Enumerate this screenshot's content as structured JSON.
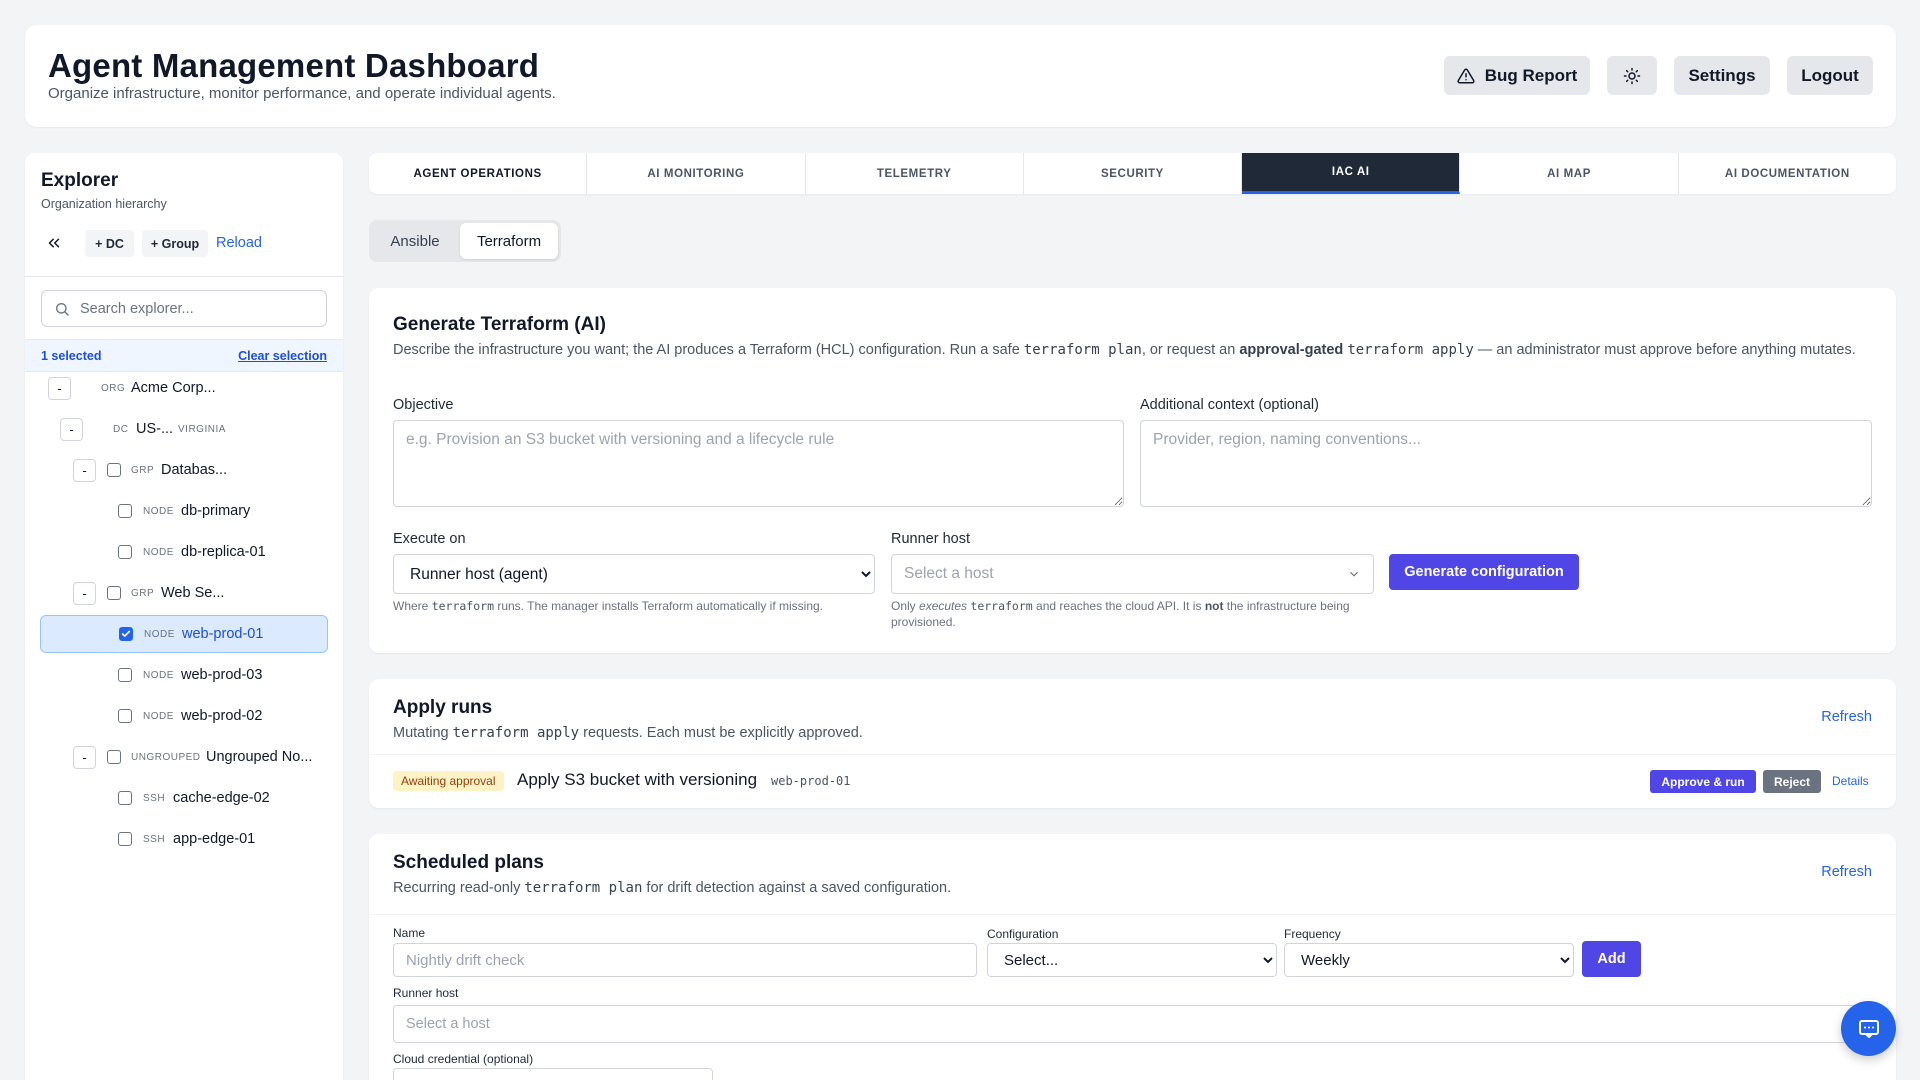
{
  "header": {
    "title": "Agent Management Dashboard",
    "subtitle": "Organize infrastructure, monitor performance, and operate individual agents.",
    "bug_report": "Bug Report",
    "settings": "Settings",
    "logout": "Logout"
  },
  "sidebar": {
    "title": "Explorer",
    "subtitle": "Organization hierarchy",
    "add_dc": "+ DC",
    "add_group": "+ Group",
    "reload": "Reload",
    "search_placeholder": "Search explorer...",
    "selected_count": "1 selected",
    "clear_selection": "Clear selection",
    "tree": [
      {
        "toggle": "-",
        "type": "ORG",
        "label": "Acme Corp...",
        "meta": "",
        "checkbox": false,
        "checked": false
      },
      {
        "toggle": "-",
        "type": "DC",
        "label": "US-...",
        "meta": "VIRGINIA",
        "checkbox": false,
        "checked": false
      },
      {
        "toggle": "-",
        "type": "GRP",
        "label": "Databas...",
        "meta": "",
        "checkbox": true,
        "checked": false
      },
      {
        "toggle": "",
        "type": "NODE",
        "label": "db-primary",
        "meta": "",
        "checkbox": true,
        "checked": false
      },
      {
        "toggle": "",
        "type": "NODE",
        "label": "db-replica-01",
        "meta": "",
        "checkbox": true,
        "checked": false
      },
      {
        "toggle": "-",
        "type": "GRP",
        "label": "Web Se...",
        "meta": "",
        "checkbox": true,
        "checked": false
      },
      {
        "toggle": "",
        "type": "NODE",
        "label": "web-prod-01",
        "meta": "",
        "checkbox": true,
        "checked": true
      },
      {
        "toggle": "",
        "type": "NODE",
        "label": "web-prod-03",
        "meta": "",
        "checkbox": true,
        "checked": false
      },
      {
        "toggle": "",
        "type": "NODE",
        "label": "web-prod-02",
        "meta": "",
        "checkbox": true,
        "checked": false
      },
      {
        "toggle": "-",
        "type": "UNGROUPED",
        "label": "Ungrouped No...",
        "meta": "",
        "checkbox": true,
        "checked": false
      },
      {
        "toggle": "",
        "type": "SSH",
        "label": "cache-edge-02",
        "meta": "",
        "checkbox": true,
        "checked": false
      },
      {
        "toggle": "",
        "type": "SSH",
        "label": "app-edge-01",
        "meta": "",
        "checkbox": true,
        "checked": false
      }
    ]
  },
  "tabs": [
    {
      "label": "AGENT OPERATIONS",
      "active": false
    },
    {
      "label": "AI MONITORING",
      "active": false
    },
    {
      "label": "TELEMETRY",
      "active": false
    },
    {
      "label": "SECURITY",
      "active": false
    },
    {
      "label": "IAC AI",
      "active": true
    },
    {
      "label": "AI MAP",
      "active": false
    },
    {
      "label": "AI DOCUMENTATION",
      "active": false
    }
  ],
  "subtabs": {
    "ansible": "Ansible",
    "terraform": "Terraform",
    "active": "Terraform"
  },
  "generate": {
    "title": "Generate Terraform (AI)",
    "desc_1": "Describe the infrastructure you want; the AI produces a Terraform (HCL) configuration. Run a safe ",
    "desc_code_1": "terraform plan",
    "desc_2": ", or request an ",
    "desc_bold": "approval-gated",
    "desc_3": " ",
    "desc_code_2": "terraform apply",
    "desc_4": " — an administrator must approve before anything mutates.",
    "objective_label": "Objective",
    "objective_placeholder": "e.g. Provision an S3 bucket with versioning and a lifecycle rule",
    "context_label": "Additional context (optional)",
    "context_placeholder": "Provider, region, naming conventions...",
    "execute_label": "Execute on",
    "execute_value": "Runner host (agent)",
    "execute_help_1": "Where ",
    "execute_help_code": "terraform",
    "execute_help_2": " runs. The manager installs Terraform automatically if missing.",
    "runner_label": "Runner host",
    "runner_placeholder": "Select a host",
    "runner_help_1": "Only ",
    "runner_help_em": "executes",
    "runner_help_2": " ",
    "runner_help_code": "terraform",
    "runner_help_3": " and reaches the cloud API. It is ",
    "runner_help_bold": "not",
    "runner_help_4": " the infrastructure being provisioned.",
    "generate_button": "Generate configuration"
  },
  "apply_runs": {
    "title": "Apply runs",
    "desc_1": "Mutating ",
    "desc_code": "terraform apply",
    "desc_2": " requests. Each must be explicitly approved.",
    "refresh": "Refresh",
    "run": {
      "status": "Awaiting approval",
      "title": "Apply S3 bucket with versioning",
      "host": "web-prod-01",
      "approve": "Approve & run",
      "reject": "Reject",
      "details": "Details"
    }
  },
  "scheduled": {
    "title": "Scheduled plans",
    "desc_1": "Recurring read-only ",
    "desc_code": "terraform plan",
    "desc_2": " for drift detection against a saved configuration.",
    "refresh": "Refresh",
    "name_label": "Name",
    "name_placeholder": "Nightly drift check",
    "config_label": "Configuration",
    "config_value": "Select...",
    "frequency_label": "Frequency",
    "frequency_value": "Weekly",
    "add": "Add",
    "runner_label": "Runner host",
    "runner_placeholder": "Select a host",
    "credential_label": "Cloud credential (optional)"
  },
  "colors": {
    "accent": "#4f46e5",
    "link": "#2563eb",
    "dark_tab": "#1f2937",
    "awaiting_bg": "#fef3c7",
    "reject": "#6b7280"
  }
}
